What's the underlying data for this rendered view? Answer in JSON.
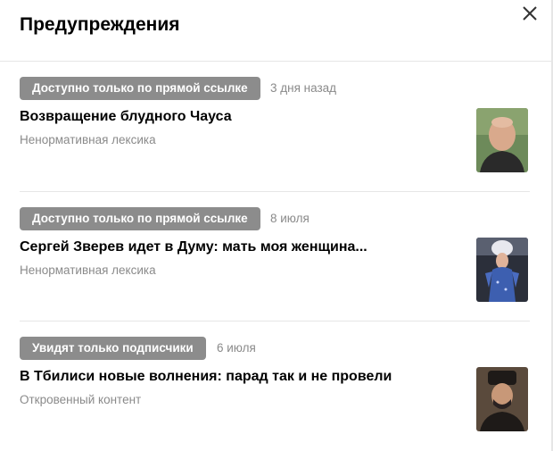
{
  "header": {
    "title": "Предупреждения",
    "close_icon": "close-icon"
  },
  "items": [
    {
      "badge": "Доступно только по прямой ссылке",
      "date": "3 дня назад",
      "headline": "Возвращение блудного Чауса",
      "reason": "Ненормативная лексика",
      "thumbnail": "man-bald-portrait"
    },
    {
      "badge": "Доступно только по прямой ссылке",
      "date": "8 июля",
      "headline": "Сергей Зверев идет в Думу: мать моя женщина...",
      "reason": "Ненормативная лексика",
      "thumbnail": "performer-costume-portrait"
    },
    {
      "badge": "Увидят только подписчики",
      "date": "6 июля",
      "headline": "В Тбилиси новые волнения: парад так и не провели",
      "reason": "Откровенный контент",
      "thumbnail": "man-papakha-portrait"
    }
  ],
  "colors": {
    "badge_bg": "#8c8c8c",
    "muted_text": "#8a8a8a",
    "divider": "#e6e6e6"
  }
}
